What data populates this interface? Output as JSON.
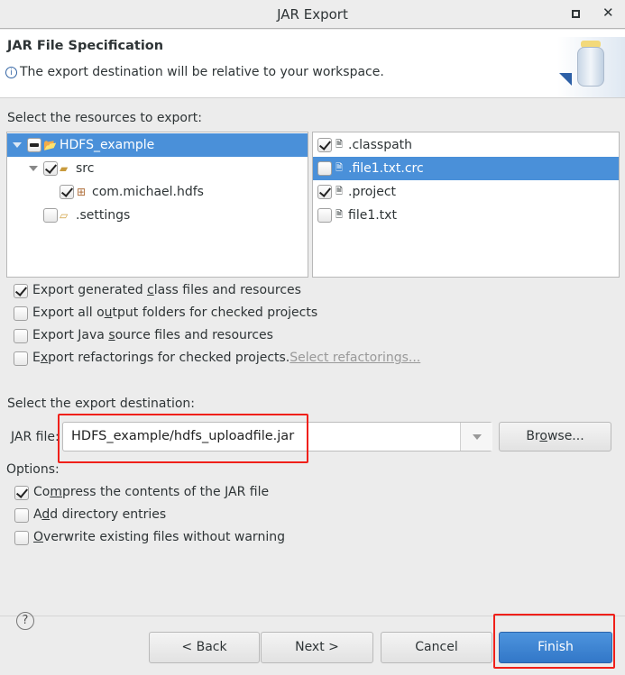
{
  "window": {
    "title": "JAR Export"
  },
  "header": {
    "title": "JAR File Specification",
    "message": "The export destination will be relative to your workspace."
  },
  "resources": {
    "label": "Select the resources to export:",
    "tree": [
      {
        "label": "HDFS_example",
        "state": "mixed",
        "selected": true,
        "icon": "project-folder-icon"
      },
      {
        "label": "src",
        "state": "checked",
        "icon": "source-folder-icon"
      },
      {
        "label": "com.michael.hdfs",
        "state": "checked",
        "icon": "package-icon"
      },
      {
        "label": ".settings",
        "state": "unchecked",
        "icon": "folder-icon"
      }
    ],
    "files": [
      {
        "label": ".classpath",
        "checked": true,
        "icon": "xml-file-icon"
      },
      {
        "label": ".file1.txt.crc",
        "checked": false,
        "selected": true,
        "icon": "text-file-icon"
      },
      {
        "label": ".project",
        "checked": true,
        "icon": "xml-file-icon"
      },
      {
        "label": "file1.txt",
        "checked": false,
        "icon": "text-file-icon"
      }
    ]
  },
  "export_options": [
    {
      "pre": "Export generated ",
      "key": "c",
      "post": "lass files and resources",
      "checked": true
    },
    {
      "pre": "Export all o",
      "key": "u",
      "post": "tput folders for checked projects",
      "checked": false
    },
    {
      "pre": "Export Java ",
      "key": "s",
      "post": "ource files and resources",
      "checked": false
    },
    {
      "pre": "E",
      "key": "x",
      "post": "port refactorings for checked projects.",
      "checked": false
    }
  ],
  "select_refactorings_link": "Select refactorings...",
  "destination": {
    "label": "Select the export destination:",
    "jar_label_key": "J",
    "jar_label_rest": "AR file:",
    "jar_value": "HDFS_example/hdfs_uploadfile.jar",
    "browse_pre": "Br",
    "browse_key": "o",
    "browse_post": "wse..."
  },
  "options": {
    "label": "Options:",
    "items": [
      {
        "pre": "Co",
        "key": "m",
        "post": "press the contents of the JAR file",
        "checked": true
      },
      {
        "pre": "A",
        "key": "d",
        "post": "d directory entries",
        "checked": false
      },
      {
        "pre": "",
        "key": "O",
        "post": "verwrite existing files without warning",
        "checked": false
      }
    ]
  },
  "buttons": {
    "back": "< Back",
    "next": "Next >",
    "cancel": "Cancel",
    "finish": "Finish"
  },
  "colors": {
    "selection": "#4a90d9",
    "primary": "#3a80d0",
    "highlight": "#f0201a"
  }
}
